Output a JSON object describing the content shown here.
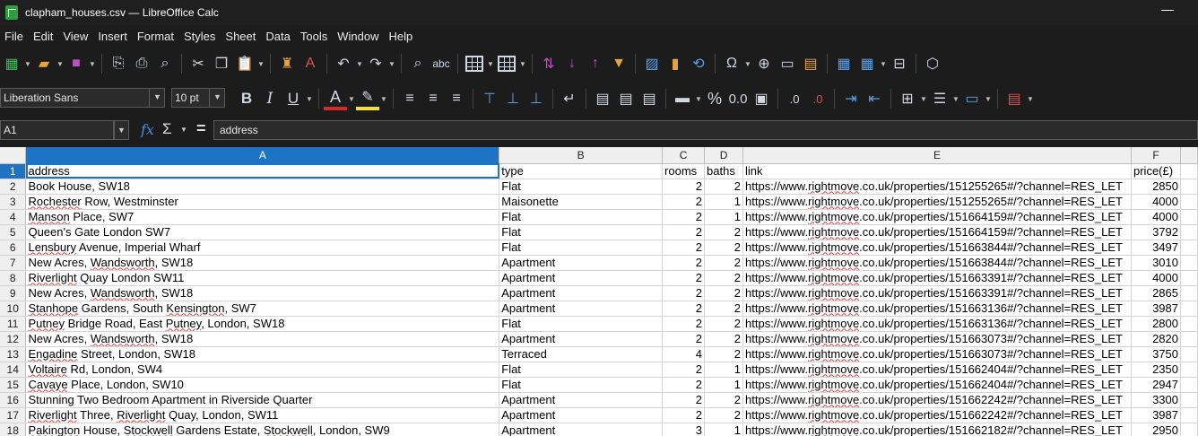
{
  "window": {
    "title": "clapham_houses.csv — LibreOffice Calc"
  },
  "menubar": [
    "File",
    "Edit",
    "View",
    "Insert",
    "Format",
    "Styles",
    "Sheet",
    "Data",
    "Tools",
    "Window",
    "Help"
  ],
  "toolbar2": {
    "font_name": "Liberation Sans",
    "font_size": "10 pt",
    "bold": "B",
    "italic": "I",
    "underline": "U",
    "font_color_glyph": "A",
    "percent": "%",
    "decimal": "0.0"
  },
  "formula_bar": {
    "name_box": "A1",
    "formula": "address"
  },
  "sheet": {
    "columns": [
      {
        "letter": "A",
        "width": 528
      },
      {
        "letter": "B",
        "width": 182
      },
      {
        "letter": "C",
        "width": 47
      },
      {
        "letter": "D",
        "width": 43
      },
      {
        "letter": "E",
        "width": 433
      },
      {
        "letter": "F",
        "width": 55
      },
      {
        "letter": "",
        "width": 19
      }
    ],
    "header_row": [
      "address",
      "type",
      "rooms",
      "baths",
      "link",
      "price(£)"
    ],
    "rows": [
      [
        "Book House, SW18",
        "Flat",
        "2",
        "2",
        "https://www.rightmove.co.uk/properties/151255265#/?channel=RES_LET",
        "2850"
      ],
      [
        "Rochester Row, Westminster",
        "Maisonette",
        "2",
        "1",
        "https://www.rightmove.co.uk/properties/151255265#/?channel=RES_LET",
        "4000"
      ],
      [
        "Manson Place, SW7",
        "Flat",
        "2",
        "1",
        "https://www.rightmove.co.uk/properties/151664159#/?channel=RES_LET",
        "4000"
      ],
      [
        "Queen's Gate London SW7",
        "Flat",
        "2",
        "2",
        "https://www.rightmove.co.uk/properties/151664159#/?channel=RES_LET",
        "3792"
      ],
      [
        "Lensbury Avenue, Imperial Wharf",
        "Flat",
        "2",
        "2",
        "https://www.rightmove.co.uk/properties/151663844#/?channel=RES_LET",
        "3497"
      ],
      [
        "New Acres, Wandsworth, SW18",
        "Apartment",
        "2",
        "2",
        "https://www.rightmove.co.uk/properties/151663844#/?channel=RES_LET",
        "3010"
      ],
      [
        "Riverlight Quay London SW11",
        "Apartment",
        "2",
        "2",
        "https://www.rightmove.co.uk/properties/151663391#/?channel=RES_LET",
        "4000"
      ],
      [
        "New Acres, Wandsworth, SW18",
        "Apartment",
        "2",
        "2",
        "https://www.rightmove.co.uk/properties/151663391#/?channel=RES_LET",
        "2865"
      ],
      [
        "Stanhope Gardens, South Kensington, SW7",
        "Apartment",
        "2",
        "2",
        "https://www.rightmove.co.uk/properties/151663136#/?channel=RES_LET",
        "3987"
      ],
      [
        "Putney Bridge Road, East Putney, London, SW18",
        "Flat",
        "2",
        "2",
        "https://www.rightmove.co.uk/properties/151663136#/?channel=RES_LET",
        "2800"
      ],
      [
        "New Acres, Wandsworth, SW18",
        "Apartment",
        "2",
        "2",
        "https://www.rightmove.co.uk/properties/151663073#/?channel=RES_LET",
        "2820"
      ],
      [
        "Engadine Street, London, SW18",
        "Terraced",
        "4",
        "2",
        "https://www.rightmove.co.uk/properties/151663073#/?channel=RES_LET",
        "3750"
      ],
      [
        "Voltaire Rd, London, SW4",
        "Flat",
        "2",
        "1",
        "https://www.rightmove.co.uk/properties/151662404#/?channel=RES_LET",
        "2350"
      ],
      [
        "Cavaye Place, London, SW10",
        "Flat",
        "2",
        "1",
        "https://www.rightmove.co.uk/properties/151662404#/?channel=RES_LET",
        "2947"
      ],
      [
        "Stunning Two Bedroom Apartment in Riverside Quarter",
        "Apartment",
        "2",
        "2",
        "https://www.rightmove.co.uk/properties/151662242#/?channel=RES_LET",
        "3300"
      ],
      [
        "Riverlight Three, Riverlight Quay, London, SW11",
        "Apartment",
        "2",
        "2",
        "https://www.rightmove.co.uk/properties/151662242#/?channel=RES_LET",
        "3987"
      ],
      [
        "Pakington House, Stockwell Gardens Estate, Stockwell, London, SW9",
        "Apartment",
        "3",
        "1",
        "https://www.rightmove.co.uk/properties/151662182#/?channel=RES_LET",
        "2950"
      ]
    ]
  },
  "colors": {
    "selection": "#1f73c4",
    "background": "#1c1c1c"
  }
}
